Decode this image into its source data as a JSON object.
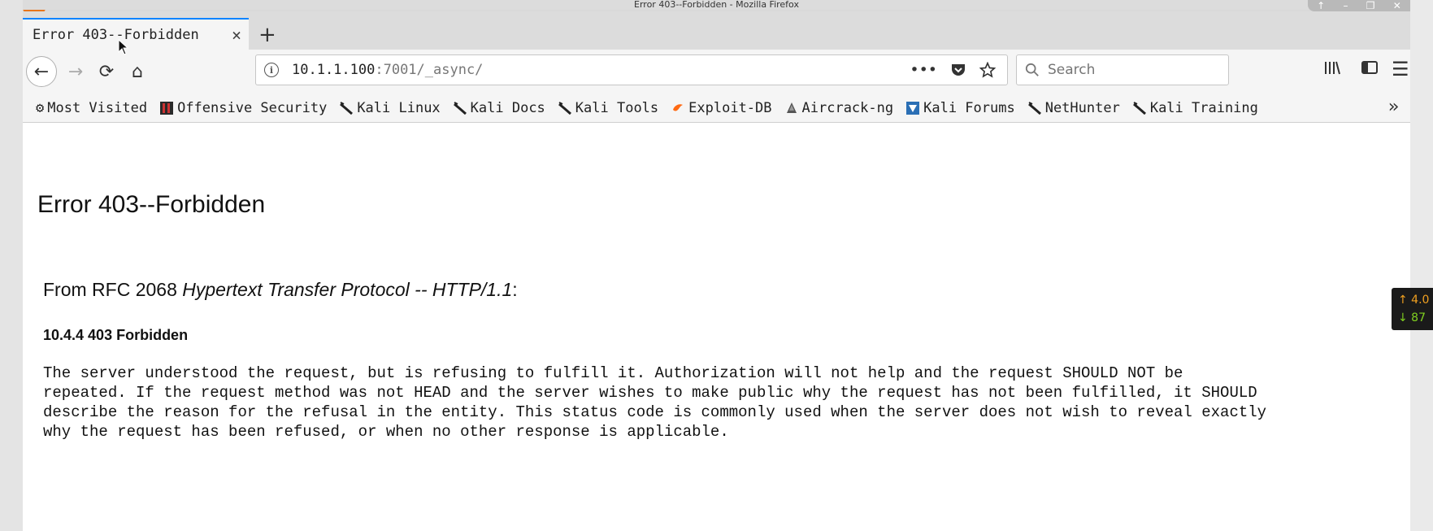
{
  "window": {
    "title": "Error 403--Forbidden - Mozilla Firefox",
    "controls": [
      "↑",
      "–",
      "❐",
      "✕"
    ]
  },
  "tab": {
    "title": "Error 403--Forbidden",
    "close": "×",
    "new_tab": "+"
  },
  "nav": {
    "back": "←",
    "forward": "→",
    "reload": "⟳",
    "home": "⌂"
  },
  "url": {
    "host": "10.1.1.100",
    "rest": ":7001/_async/",
    "more": "•••"
  },
  "search": {
    "placeholder": "Search"
  },
  "bookmarks": [
    {
      "label": "Most Visited",
      "icon": "gear-icon"
    },
    {
      "label": "Offensive Security",
      "icon": "offsec-icon"
    },
    {
      "label": "Kali Linux",
      "icon": "kali-dragon-icon"
    },
    {
      "label": "Kali Docs",
      "icon": "kali-dragon-icon"
    },
    {
      "label": "Kali Tools",
      "icon": "kali-dragon-icon"
    },
    {
      "label": "Exploit-DB",
      "icon": "exploitdb-icon"
    },
    {
      "label": "Aircrack-ng",
      "icon": "aircrack-icon"
    },
    {
      "label": "Kali Forums",
      "icon": "kali-forums-icon"
    },
    {
      "label": "NetHunter",
      "icon": "kali-dragon-icon"
    },
    {
      "label": "Kali Training",
      "icon": "kali-dragon-icon"
    }
  ],
  "bookmarks_overflow": "»",
  "page": {
    "heading": "Error 403--Forbidden",
    "rfc_prefix": "From RFC 2068 ",
    "rfc_title": "Hypertext Transfer Protocol -- HTTP/1.1",
    "rfc_suffix": ":",
    "subheading": "10.4.4 403 Forbidden",
    "body": "The server understood the request, but is refusing to fulfill it. Authorization will not help and the request SHOULD NOT be\nrepeated. If the request method was not HEAD and the server wishes to make public why the request has not been fulfilled, it SHOULD\ndescribe the reason for the refusal in the entity. This status code is commonly used when the server does not wish to reveal exactly\nwhy the request has been refused, or when no other response is applicable."
  },
  "netmon": {
    "up": "↑ 4.0",
    "down": "↓ 87"
  },
  "colors": {
    "tab_accent": "#0a84ff",
    "app_badge": "#e8751a",
    "exploitdb": "#ff6a13"
  }
}
